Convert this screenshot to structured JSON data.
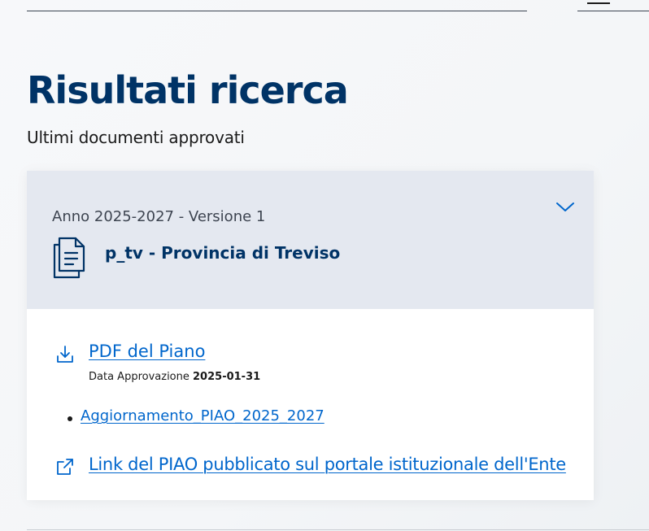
{
  "page": {
    "title": "Risultati ricerca",
    "subtitle": "Ultimi documenti approvati"
  },
  "result": {
    "meta": "Anno 2025-2027 - Versione 1",
    "title": "p_tv - Provincia di Treviso",
    "pdf_link": "PDF del Piano",
    "approval_label": "Data Approvazione",
    "approval_date": "2025-01-31",
    "attachments": [
      "Aggiornamento_PIAO_2025_2027"
    ],
    "external_link": "Link del PIAO pubblicato sul portale istituzionale dell'Ente"
  },
  "colors": {
    "title": "#003366",
    "link": "#0066cc",
    "header_bg": "#e4e8f0"
  },
  "icons": {
    "document": "document-icon",
    "expand": "chevron-down-icon",
    "download": "download-icon",
    "external": "external-link-icon"
  }
}
